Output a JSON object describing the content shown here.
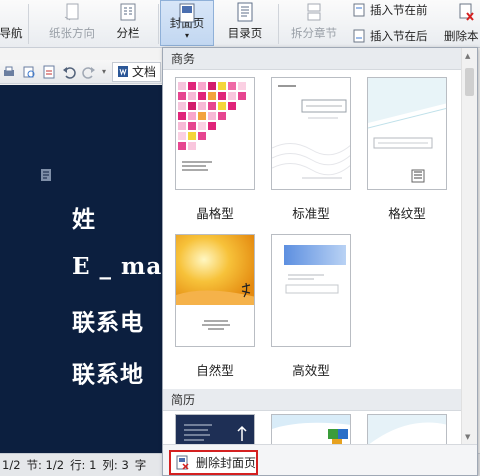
{
  "ribbon": {
    "nav": "导航",
    "paper_direction": "纸张方向",
    "columns": "分栏",
    "cover_page": "封面页",
    "toc_page": "目录页",
    "split_section": "拆分章节",
    "insert_section_before": "插入节在前",
    "insert_section_after": "插入节在后",
    "delete_section": "删除本"
  },
  "quickbar": {
    "doc_tab": "文档"
  },
  "document": {
    "lines": [
      "姓",
      "E _ mai",
      "联系电",
      "联系地"
    ]
  },
  "dropdown": {
    "sections": [
      {
        "title": "商务",
        "templates": [
          {
            "label": "晶格型",
            "style": "crystal"
          },
          {
            "label": "标准型",
            "style": "standard"
          },
          {
            "label": "格纹型",
            "style": "grid"
          },
          {
            "label": "自然型",
            "style": "nature"
          },
          {
            "label": "高效型",
            "style": "efficient"
          }
        ]
      },
      {
        "title": "简历"
      }
    ],
    "delete_button": "删除封面页"
  },
  "status": {
    "page": "1/2",
    "section": "节: 1/2",
    "row": "行: 1",
    "col": "列: 3",
    "words": "字"
  },
  "colors": {
    "doc_background": "#0c1f3f",
    "delete_highlight": "#d42020",
    "crystal_pink": "#e0257a",
    "nature_gold": "#f0a020",
    "efficient_blue": "#6f9fe0"
  }
}
